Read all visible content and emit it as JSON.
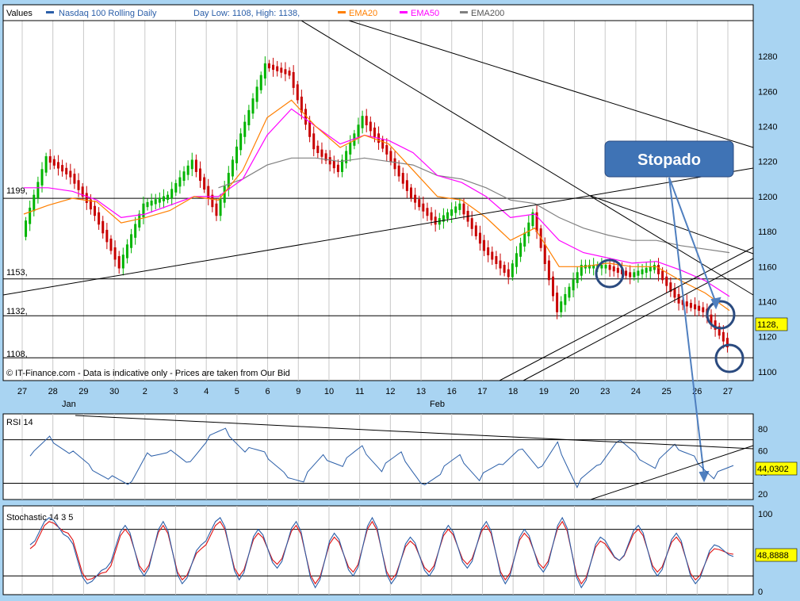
{
  "legend": {
    "values_label": "Values",
    "series_label": "Nasdaq 100 Rolling Daily",
    "day_range": "Day Low: 1108, High: 1138,",
    "ema20": "EMA20",
    "ema50": "EMA50",
    "ema200": "EMA200"
  },
  "colors": {
    "background": "#a9d4f2",
    "price_up": "#00b400",
    "price_down": "#c80000",
    "ema20": "#ff7f00",
    "ema50": "#ff00ff",
    "ema200": "#808080",
    "rsi": "#2a5ea8",
    "stoch_k": "#2a5ea8",
    "stoch_d": "#e01010",
    "callout_fill": "#3f73b5",
    "circle_stroke": "#2a4a7f",
    "value_tag": "#ffff00"
  },
  "annotations": {
    "callout": "Stopado",
    "source_note": "© IT-Finance.com - Data is indicative only - Prices are taken from Our Bid"
  },
  "chart_data": [
    {
      "type": "candlestick",
      "title": "Nasdaq 100 Rolling Daily",
      "categories": [
        "27",
        "28",
        "29",
        "30",
        "2",
        "3",
        "4",
        "5",
        "6",
        "9",
        "10",
        "11",
        "12",
        "13",
        "16",
        "17",
        "18",
        "19",
        "20",
        "23",
        "24",
        "25",
        "26",
        "27"
      ],
      "month_labels": [
        {
          "label": "Jan",
          "at": "28"
        },
        {
          "label": "Feb",
          "at": "13"
        }
      ],
      "ylim": [
        1100,
        1290
      ],
      "y_ticks": [
        1100,
        1120,
        1140,
        1160,
        1180,
        1200,
        1220,
        1240,
        1260,
        1280
      ],
      "horizontal_levels": [
        {
          "label": "1199,",
          "value": 1199
        },
        {
          "label": "1153,",
          "value": 1153
        },
        {
          "label": "1132,",
          "value": 1132
        },
        {
          "label": "1108,",
          "value": 1108
        }
      ],
      "last_value_tag": "1128,",
      "close": [
        1178,
        1222,
        1212,
        1190,
        1160,
        1195,
        1200,
        1220,
        1190,
        1235,
        1275,
        1270,
        1228,
        1215,
        1245,
        1225,
        1200,
        1185,
        1195,
        1170,
        1155,
        1190,
        1135,
        1160,
        1160,
        1155,
        1160,
        1140,
        1135,
        1115
      ],
      "ema20": [
        1190,
        1195,
        1199,
        1197,
        1185,
        1188,
        1192,
        1200,
        1198,
        1215,
        1245,
        1255,
        1240,
        1228,
        1235,
        1230,
        1215,
        1200,
        1198,
        1188,
        1175,
        1182,
        1160,
        1160,
        1162,
        1160,
        1160,
        1152,
        1145,
        1135
      ],
      "ema50": [
        1205,
        1205,
        1203,
        1198,
        1188,
        1190,
        1195,
        1200,
        1200,
        1210,
        1235,
        1250,
        1240,
        1230,
        1235,
        1232,
        1225,
        1212,
        1208,
        1200,
        1188,
        1190,
        1175,
        1168,
        1165,
        1162,
        1163,
        1158,
        1152,
        1143
      ],
      "ema200": [
        null,
        null,
        null,
        null,
        null,
        null,
        null,
        null,
        1205,
        1210,
        1218,
        1222,
        1222,
        1220,
        1222,
        1220,
        1218,
        1212,
        1210,
        1205,
        1198,
        1196,
        1188,
        1182,
        1178,
        1175,
        1175,
        1172,
        1170,
        1168
      ],
      "series": [
        {
          "name": "EMA20",
          "key": "ema20"
        },
        {
          "name": "EMA50",
          "key": "ema50"
        },
        {
          "name": "EMA200",
          "key": "ema200"
        }
      ]
    },
    {
      "type": "line",
      "title": "RSI 14",
      "ylim": [
        20,
        85
      ],
      "y_ticks": [
        20,
        40,
        60,
        80
      ],
      "last_value_tag": "44,0302",
      "values": [
        55,
        72,
        60,
        45,
        35,
        25,
        58,
        62,
        48,
        70,
        78,
        60,
        55,
        40,
        35,
        55,
        48,
        62,
        42,
        55,
        30,
        42,
        55,
        35,
        45,
        62,
        40,
        68,
        30,
        45,
        70,
        55,
        45,
        62,
        55,
        38,
        45
      ]
    },
    {
      "type": "line",
      "title": "Stochastic 14 3 5",
      "ylim": [
        0,
        100
      ],
      "y_ticks": [
        0,
        50,
        100
      ],
      "last_value_tag": "48,8888",
      "series": [
        {
          "name": "%K",
          "values": [
            60,
            95,
            70,
            10,
            30,
            85,
            20,
            90,
            10,
            60,
            95,
            15,
            80,
            30,
            90,
            5,
            75,
            20,
            95,
            10,
            70,
            20,
            85,
            30,
            90,
            10,
            80,
            25,
            95,
            5,
            70,
            40,
            85,
            20,
            75,
            10,
            60,
            45
          ]
        },
        {
          "name": "%D",
          "values": [
            55,
            90,
            75,
            15,
            25,
            80,
            25,
            85,
            15,
            55,
            90,
            20,
            75,
            35,
            85,
            10,
            70,
            25,
            90,
            15,
            65,
            25,
            80,
            35,
            85,
            15,
            75,
            30,
            90,
            10,
            65,
            40,
            80,
            25,
            70,
            15,
            55,
            48
          ]
        }
      ]
    }
  ]
}
